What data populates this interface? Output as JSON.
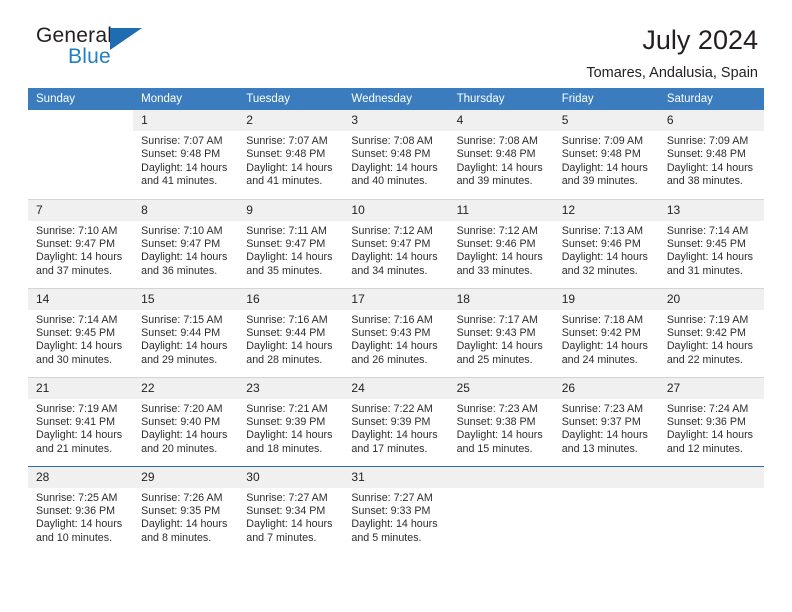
{
  "brand": {
    "word_general": "General",
    "word_blue": "Blue",
    "triangle_color": "#1f6cb0",
    "blue_text_color": "#2081c3"
  },
  "header": {
    "title": "July 2024",
    "subtitle": "Tomares, Andalusia, Spain"
  },
  "theme": {
    "header_row_bg": "#3a7cbe",
    "daynum_bg": "#f0f0f0",
    "grid_line": "#d4d4d4",
    "last_row_border": "#2e6da4"
  },
  "weekday_headers": [
    "Sunday",
    "Monday",
    "Tuesday",
    "Wednesday",
    "Thursday",
    "Friday",
    "Saturday"
  ],
  "weeks": [
    [
      {
        "day": "",
        "lines": []
      },
      {
        "day": "1",
        "lines": [
          "Sunrise: 7:07 AM",
          "Sunset: 9:48 PM",
          "Daylight: 14 hours",
          "and 41 minutes."
        ]
      },
      {
        "day": "2",
        "lines": [
          "Sunrise: 7:07 AM",
          "Sunset: 9:48 PM",
          "Daylight: 14 hours",
          "and 41 minutes."
        ]
      },
      {
        "day": "3",
        "lines": [
          "Sunrise: 7:08 AM",
          "Sunset: 9:48 PM",
          "Daylight: 14 hours",
          "and 40 minutes."
        ]
      },
      {
        "day": "4",
        "lines": [
          "Sunrise: 7:08 AM",
          "Sunset: 9:48 PM",
          "Daylight: 14 hours",
          "and 39 minutes."
        ]
      },
      {
        "day": "5",
        "lines": [
          "Sunrise: 7:09 AM",
          "Sunset: 9:48 PM",
          "Daylight: 14 hours",
          "and 39 minutes."
        ]
      },
      {
        "day": "6",
        "lines": [
          "Sunrise: 7:09 AM",
          "Sunset: 9:48 PM",
          "Daylight: 14 hours",
          "and 38 minutes."
        ]
      }
    ],
    [
      {
        "day": "7",
        "lines": [
          "Sunrise: 7:10 AM",
          "Sunset: 9:47 PM",
          "Daylight: 14 hours",
          "and 37 minutes."
        ]
      },
      {
        "day": "8",
        "lines": [
          "Sunrise: 7:10 AM",
          "Sunset: 9:47 PM",
          "Daylight: 14 hours",
          "and 36 minutes."
        ]
      },
      {
        "day": "9",
        "lines": [
          "Sunrise: 7:11 AM",
          "Sunset: 9:47 PM",
          "Daylight: 14 hours",
          "and 35 minutes."
        ]
      },
      {
        "day": "10",
        "lines": [
          "Sunrise: 7:12 AM",
          "Sunset: 9:47 PM",
          "Daylight: 14 hours",
          "and 34 minutes."
        ]
      },
      {
        "day": "11",
        "lines": [
          "Sunrise: 7:12 AM",
          "Sunset: 9:46 PM",
          "Daylight: 14 hours",
          "and 33 minutes."
        ]
      },
      {
        "day": "12",
        "lines": [
          "Sunrise: 7:13 AM",
          "Sunset: 9:46 PM",
          "Daylight: 14 hours",
          "and 32 minutes."
        ]
      },
      {
        "day": "13",
        "lines": [
          "Sunrise: 7:14 AM",
          "Sunset: 9:45 PM",
          "Daylight: 14 hours",
          "and 31 minutes."
        ]
      }
    ],
    [
      {
        "day": "14",
        "lines": [
          "Sunrise: 7:14 AM",
          "Sunset: 9:45 PM",
          "Daylight: 14 hours",
          "and 30 minutes."
        ]
      },
      {
        "day": "15",
        "lines": [
          "Sunrise: 7:15 AM",
          "Sunset: 9:44 PM",
          "Daylight: 14 hours",
          "and 29 minutes."
        ]
      },
      {
        "day": "16",
        "lines": [
          "Sunrise: 7:16 AM",
          "Sunset: 9:44 PM",
          "Daylight: 14 hours",
          "and 28 minutes."
        ]
      },
      {
        "day": "17",
        "lines": [
          "Sunrise: 7:16 AM",
          "Sunset: 9:43 PM",
          "Daylight: 14 hours",
          "and 26 minutes."
        ]
      },
      {
        "day": "18",
        "lines": [
          "Sunrise: 7:17 AM",
          "Sunset: 9:43 PM",
          "Daylight: 14 hours",
          "and 25 minutes."
        ]
      },
      {
        "day": "19",
        "lines": [
          "Sunrise: 7:18 AM",
          "Sunset: 9:42 PM",
          "Daylight: 14 hours",
          "and 24 minutes."
        ]
      },
      {
        "day": "20",
        "lines": [
          "Sunrise: 7:19 AM",
          "Sunset: 9:42 PM",
          "Daylight: 14 hours",
          "and 22 minutes."
        ]
      }
    ],
    [
      {
        "day": "21",
        "lines": [
          "Sunrise: 7:19 AM",
          "Sunset: 9:41 PM",
          "Daylight: 14 hours",
          "and 21 minutes."
        ]
      },
      {
        "day": "22",
        "lines": [
          "Sunrise: 7:20 AM",
          "Sunset: 9:40 PM",
          "Daylight: 14 hours",
          "and 20 minutes."
        ]
      },
      {
        "day": "23",
        "lines": [
          "Sunrise: 7:21 AM",
          "Sunset: 9:39 PM",
          "Daylight: 14 hours",
          "and 18 minutes."
        ]
      },
      {
        "day": "24",
        "lines": [
          "Sunrise: 7:22 AM",
          "Sunset: 9:39 PM",
          "Daylight: 14 hours",
          "and 17 minutes."
        ]
      },
      {
        "day": "25",
        "lines": [
          "Sunrise: 7:23 AM",
          "Sunset: 9:38 PM",
          "Daylight: 14 hours",
          "and 15 minutes."
        ]
      },
      {
        "day": "26",
        "lines": [
          "Sunrise: 7:23 AM",
          "Sunset: 9:37 PM",
          "Daylight: 14 hours",
          "and 13 minutes."
        ]
      },
      {
        "day": "27",
        "lines": [
          "Sunrise: 7:24 AM",
          "Sunset: 9:36 PM",
          "Daylight: 14 hours",
          "and 12 minutes."
        ]
      }
    ],
    [
      {
        "day": "28",
        "lines": [
          "Sunrise: 7:25 AM",
          "Sunset: 9:36 PM",
          "Daylight: 14 hours",
          "and 10 minutes."
        ]
      },
      {
        "day": "29",
        "lines": [
          "Sunrise: 7:26 AM",
          "Sunset: 9:35 PM",
          "Daylight: 14 hours",
          "and 8 minutes."
        ]
      },
      {
        "day": "30",
        "lines": [
          "Sunrise: 7:27 AM",
          "Sunset: 9:34 PM",
          "Daylight: 14 hours",
          "and 7 minutes."
        ]
      },
      {
        "day": "31",
        "lines": [
          "Sunrise: 7:27 AM",
          "Sunset: 9:33 PM",
          "Daylight: 14 hours",
          "and 5 minutes."
        ]
      },
      {
        "day": "",
        "lines": []
      },
      {
        "day": "",
        "lines": []
      },
      {
        "day": "",
        "lines": []
      }
    ]
  ]
}
